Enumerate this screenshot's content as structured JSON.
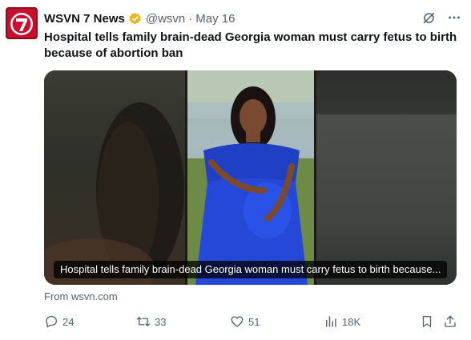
{
  "tweet": {
    "display_name": "WSVN 7 News",
    "handle": "@wsvn",
    "separator": "·",
    "date": "May 16",
    "text": "Hospital tells family brain-dead Georgia woman must carry fetus to birth because of abortion ban",
    "verified_color": "#e8b829",
    "avatar_color": "#c8102e"
  },
  "media": {
    "caption": "Hospital tells family brain-dead Georgia woman must carry fetus to birth because..."
  },
  "source": {
    "label": "From wsvn.com"
  },
  "actions": {
    "reply_count": "24",
    "retweet_count": "33",
    "like_count": "51",
    "view_count": "18K"
  },
  "icons": [
    "grok-icon",
    "more-icon",
    "reply-icon",
    "retweet-icon",
    "like-icon",
    "views-icon",
    "bookmark-icon",
    "share-icon"
  ]
}
